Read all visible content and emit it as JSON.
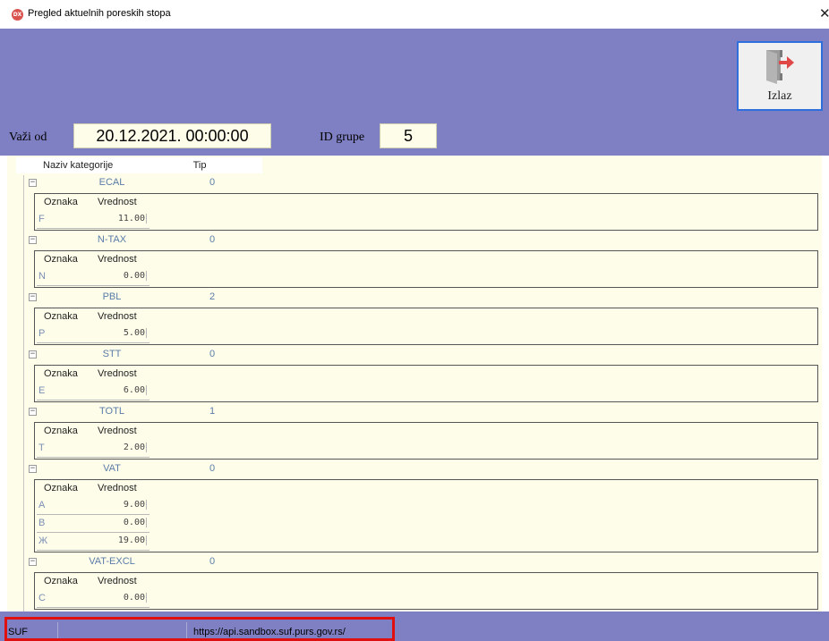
{
  "window": {
    "title": "Pregled aktuelnih poreskih stopa",
    "close": "✕"
  },
  "app_icon": {
    "text": "DX",
    "icon": "app-icon"
  },
  "header": {
    "exit_label": "Izlaz",
    "exit_icon": "exit-door-icon"
  },
  "filters": {
    "vazi_od_label": "Važi od",
    "vazi_od_value": "20.12.2021. 00:00:00",
    "id_grupe_label": "ID grupe",
    "id_grupe_value": "5"
  },
  "grid": {
    "columns": {
      "naziv": "Naziv kategorije",
      "tip": "Tip"
    },
    "detail_columns": {
      "oznaka": "Oznaka",
      "vrednost": "Vrednost"
    },
    "groups": [
      {
        "name": "ECAL",
        "tip": "0",
        "rates": [
          {
            "code": "F",
            "value": "11.00"
          }
        ]
      },
      {
        "name": "N-TAX",
        "tip": "0",
        "rates": [
          {
            "code": "N",
            "value": "0.00"
          }
        ]
      },
      {
        "name": "PBL",
        "tip": "2",
        "rates": [
          {
            "code": "P",
            "value": "5.00"
          }
        ]
      },
      {
        "name": "STT",
        "tip": "0",
        "rates": [
          {
            "code": "E",
            "value": "6.00"
          }
        ]
      },
      {
        "name": "TOTL",
        "tip": "1",
        "rates": [
          {
            "code": "T",
            "value": "2.00"
          }
        ]
      },
      {
        "name": "VAT",
        "tip": "0",
        "rates": [
          {
            "code": "A",
            "value": "9.00"
          },
          {
            "code": "B",
            "value": "0.00"
          },
          {
            "code": "Ж",
            "value": "19.00"
          }
        ]
      },
      {
        "name": "VAT-EXCL",
        "tip": "0",
        "rates": [
          {
            "code": "C",
            "value": "0.00"
          }
        ]
      }
    ]
  },
  "statusbar": {
    "left": "SUF",
    "url": "https://api.sandbox.suf.purs.gov.rs/"
  },
  "colors": {
    "header": "#7f80c3",
    "grid_bg": "#fefde9",
    "highlight": "#e01010",
    "exit_border": "#2f6fdc"
  }
}
